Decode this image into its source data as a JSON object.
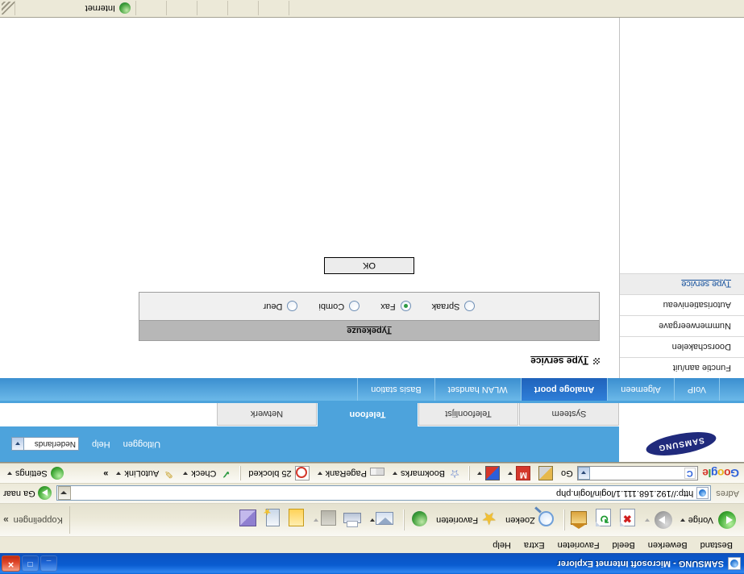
{
  "window": {
    "title": "SAMSUNG - Microsoft Internet Explorer",
    "minimize_label": "_",
    "maximize_label": "□",
    "close_label": "✕"
  },
  "menu": {
    "items": [
      {
        "label": "Bestand"
      },
      {
        "label": "Bewerken"
      },
      {
        "label": "Beeld"
      },
      {
        "label": "Favorieten"
      },
      {
        "label": "Extra"
      },
      {
        "label": "Help"
      }
    ]
  },
  "toolbar": {
    "back_label": "Vorige",
    "forward_label": "",
    "stop_label": "",
    "refresh_label": "",
    "home_label": "",
    "search_label": "Zoeken",
    "favorites_label": "Favorieten",
    "media_label": "",
    "mail_label": "",
    "print_label": "",
    "edit_label": "",
    "discuss_label": "",
    "messenger_label": "",
    "research_label": "",
    "links_label": "Koppelingen",
    "overflow_label": "»"
  },
  "address": {
    "label": "Adres",
    "url": "http://192.168.111.1/login/login.php",
    "go_label": "Ga naar"
  },
  "google_toolbar": {
    "logo": "Google",
    "search_value": "",
    "search_prefix": "C",
    "go_label": "Go",
    "bookmarks_label": "Bookmarks",
    "pagerank_label": "PageRank",
    "blocked_label": "25 blocked",
    "check_label": "Check",
    "autolink_label": "AutoLink",
    "overflow_label": "»",
    "settings_label": "Settings"
  },
  "page": {
    "brand": "SAMSUNG",
    "header_links": [
      {
        "label": "Uitloggen"
      },
      {
        "label": "Help"
      }
    ],
    "language": {
      "selected": "Nederlands"
    },
    "tabs": [
      {
        "label": "Systeem",
        "active": false
      },
      {
        "label": "Telefoonlijst",
        "active": false
      },
      {
        "label": "Telefoon",
        "active": true
      },
      {
        "label": "Netwerk",
        "active": false
      }
    ],
    "subnav": [
      {
        "label": "VoIP",
        "active": false
      },
      {
        "label": "Algemeen",
        "active": false
      },
      {
        "label": "Analoge poort",
        "active": true
      },
      {
        "label": "WLAN handset",
        "active": false
      },
      {
        "label": "Basis station",
        "active": false
      }
    ],
    "sidebar": [
      {
        "label": "Functie aan/uit",
        "active": false
      },
      {
        "label": "Doorschakelen",
        "active": false
      },
      {
        "label": "Nummerweergave",
        "active": false
      },
      {
        "label": "Autorisatieniveau",
        "active": false
      },
      {
        "label": "Type service",
        "active": true
      }
    ],
    "main": {
      "title": "Type service",
      "panel_title": "Typekeuze",
      "options": [
        {
          "label": "Spraak",
          "checked": false
        },
        {
          "label": "Fax",
          "checked": true
        },
        {
          "label": "Combi",
          "checked": false
        },
        {
          "label": "Deur",
          "checked": false
        }
      ],
      "submit_label": "OK"
    }
  },
  "statusbar": {
    "text": "",
    "zone_label": "Internet"
  }
}
